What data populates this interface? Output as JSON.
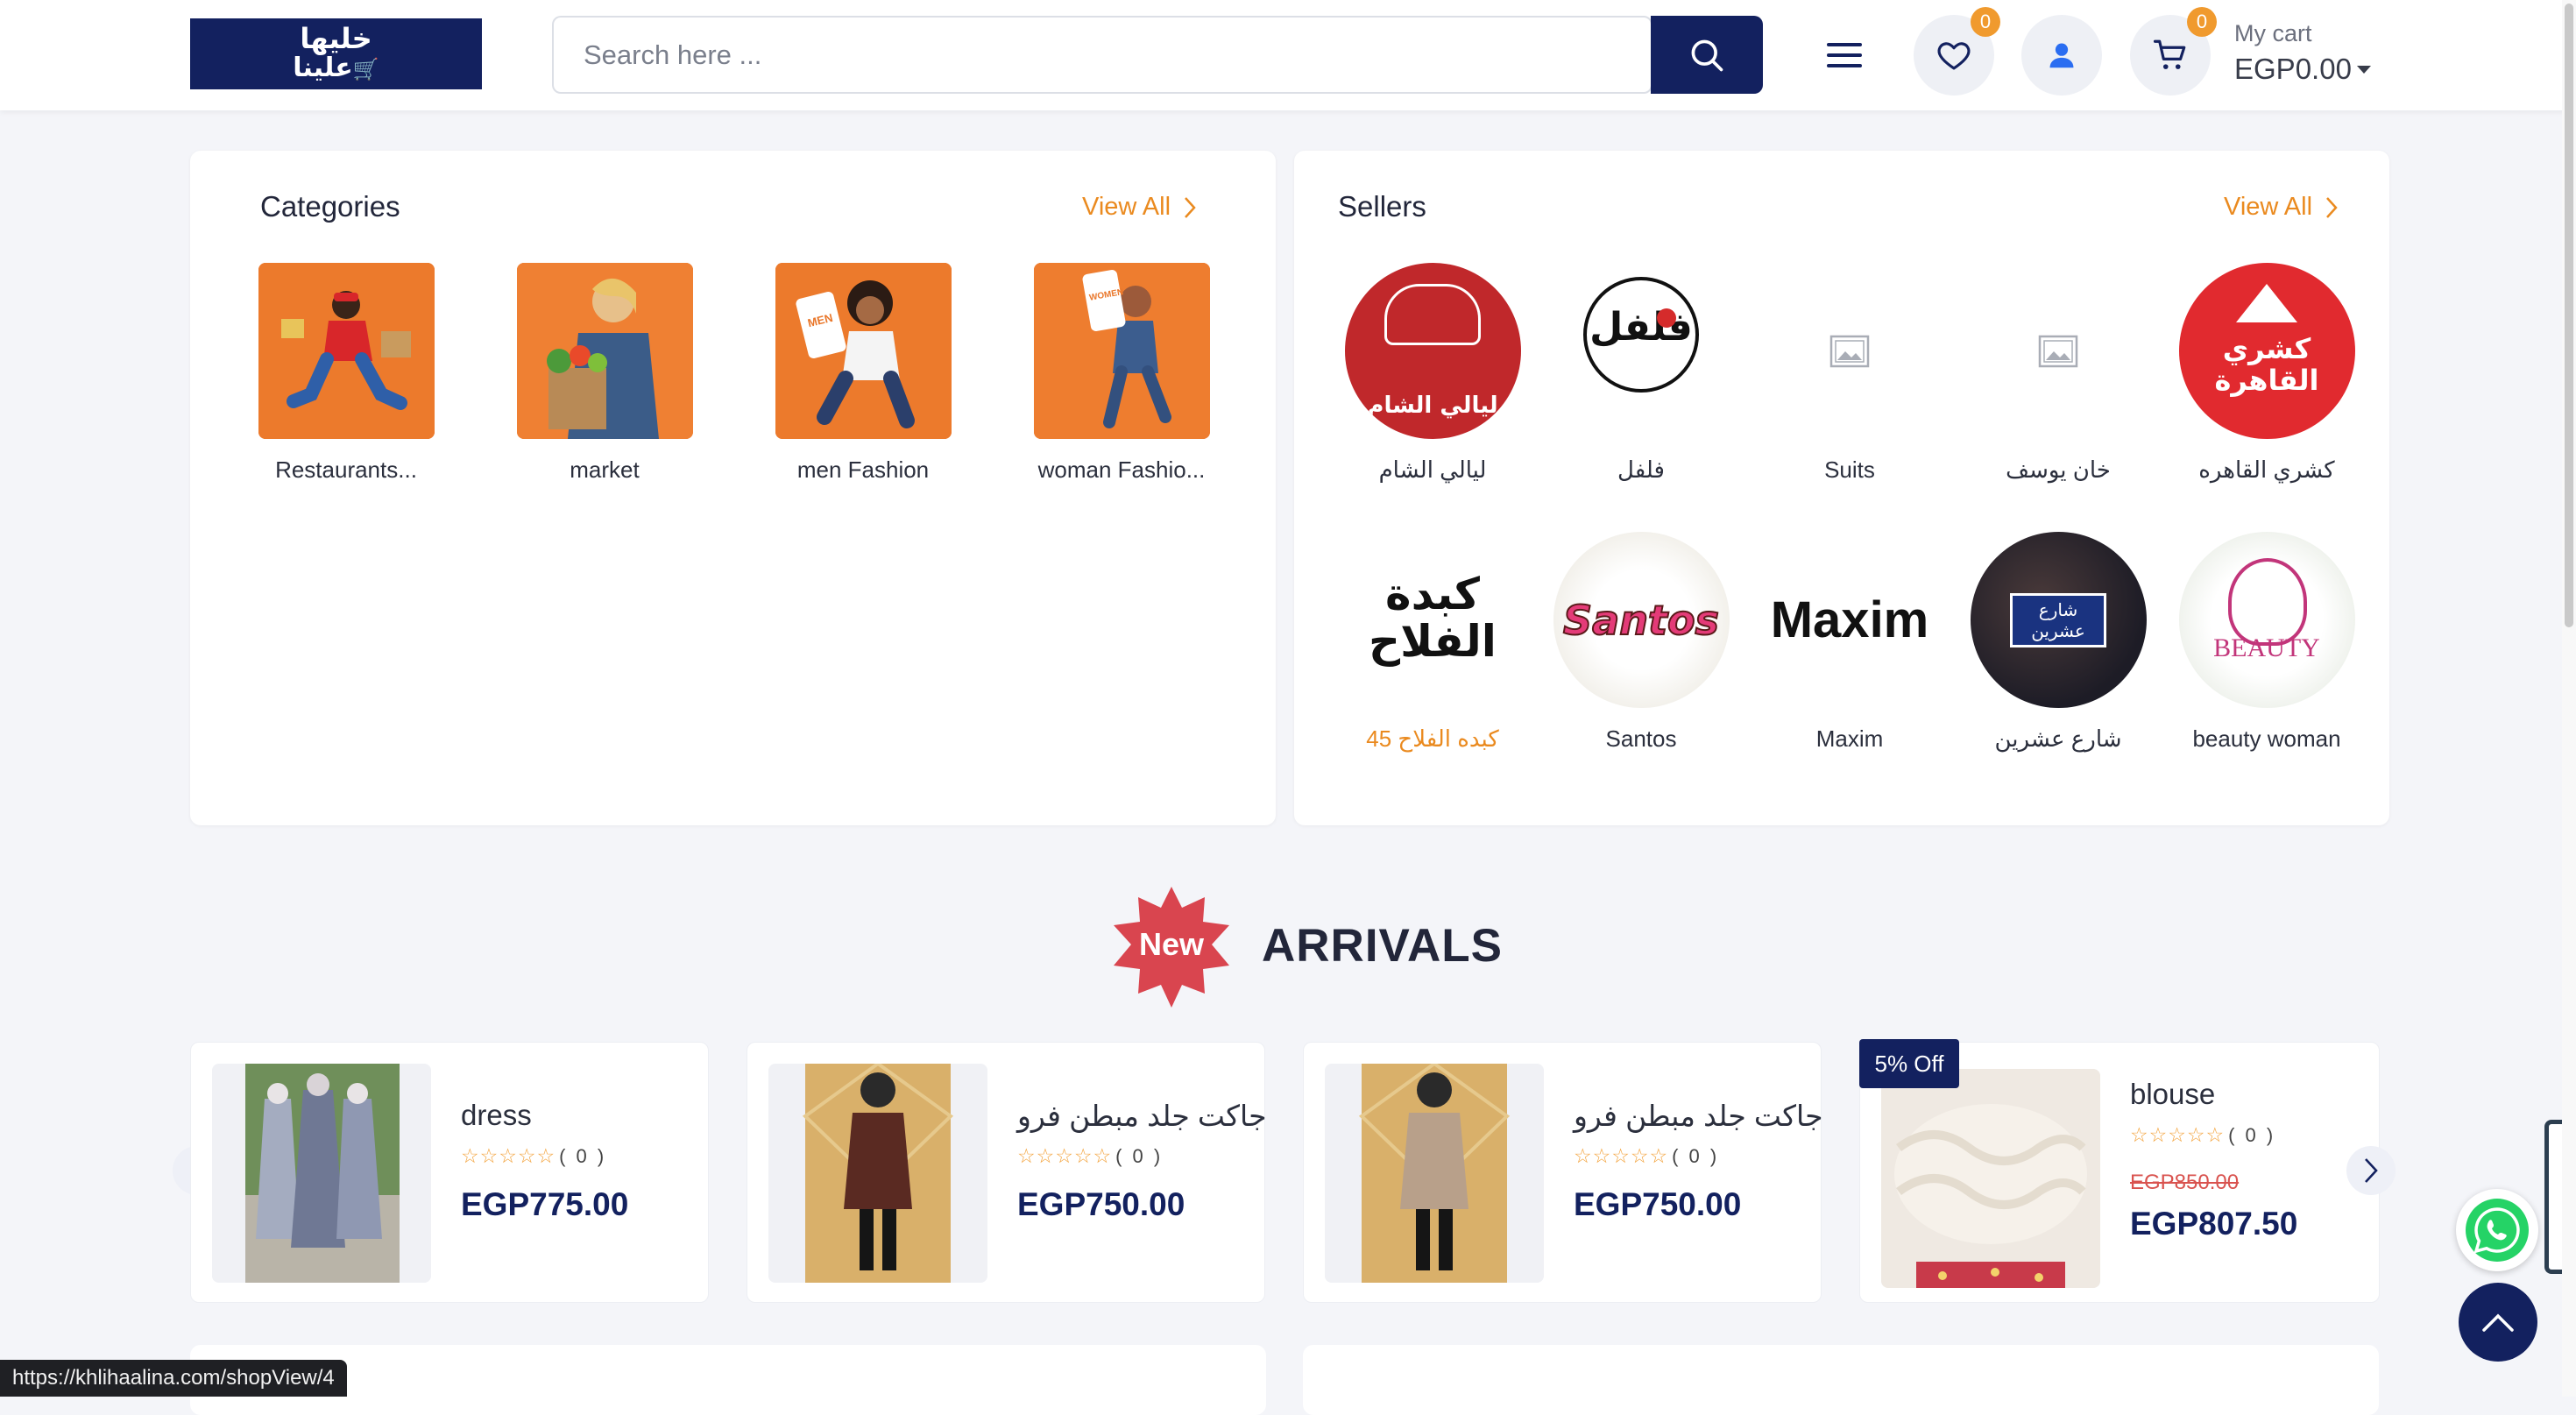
{
  "header": {
    "logo_line1": "خليها",
    "logo_line2": "علينا",
    "search_placeholder": "Search here ...",
    "wishlist_count": "0",
    "cart_count": "0",
    "cart_label": "My cart",
    "cart_total": "EGP0.00"
  },
  "categories": {
    "title": "Categories",
    "view_all": "View All",
    "items": [
      {
        "name": "Restaurants..."
      },
      {
        "name": "market"
      },
      {
        "name": "men Fashion"
      },
      {
        "name": "woman Fashio..."
      }
    ]
  },
  "sellers": {
    "title": "Sellers",
    "view_all": "View All",
    "items": [
      {
        "name": "ليالي الشام",
        "logo_text": "ليالي الشام"
      },
      {
        "name": "فلفل",
        "logo_text": "فلفل"
      },
      {
        "name": "Suits"
      },
      {
        "name": "خان يوسف"
      },
      {
        "name": "كشري القاهره",
        "logo_text": "كشري القاهرة"
      },
      {
        "name": "كبده الفلاح 45",
        "logo_text": "كبدة الفلاح"
      },
      {
        "name": "Santos",
        "logo_text": "Santos"
      },
      {
        "name": "Maxim",
        "logo_text": "Maxim"
      },
      {
        "name": "شارع عشرين",
        "logo_text": "شارع عشرين"
      },
      {
        "name": "beauty woman",
        "logo_text": "BEAUTY"
      }
    ]
  },
  "arrivals": {
    "badge": "New",
    "title": "ARRIVALS",
    "products": [
      {
        "name": "dress",
        "rating_count": "( 0 )",
        "price": "EGP775.00"
      },
      {
        "name": "جاكت جلد مبطن فرو",
        "rating_count": "( 0 )",
        "price": "EGP750.00"
      },
      {
        "name": "جاكت جلد مبطن فرو",
        "rating_count": "( 0 )",
        "price": "EGP750.00"
      },
      {
        "name": "blouse",
        "rating_count": "( 0 )",
        "old_price": "EGP850.00",
        "price": "EGP807.50",
        "discount": "5% Off"
      }
    ]
  },
  "status_url": "https://khlihaalina.com/shopView/4",
  "colors": {
    "brand_navy": "#13215f",
    "accent_orange": "#ea8a1f",
    "badge_orange": "#f09a2e",
    "background": "#f4f5f9"
  },
  "icons": [
    "search-icon",
    "menu-icon",
    "heart-icon",
    "user-icon",
    "cart-icon",
    "chevron-right-icon",
    "chevron-left-icon",
    "whatsapp-icon",
    "arrow-up-icon",
    "image-placeholder-icon",
    "star-icon"
  ]
}
